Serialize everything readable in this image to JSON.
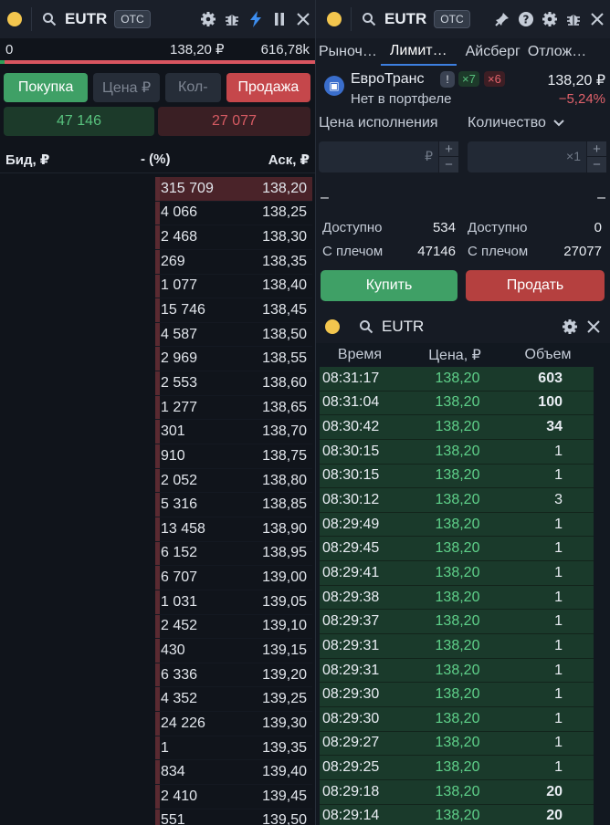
{
  "book": {
    "symbol": "EUTR",
    "otc_label": "OTC",
    "bid_volume_text": "0",
    "last_price": "138,20 ₽",
    "ask_volume_text": "616,78k",
    "buy_label": "Покупка",
    "price_field": "Цена ₽",
    "qty_field": "Кол-",
    "sell_label": "Продажа",
    "buy_volume": "47 146",
    "sell_volume": "27 077",
    "col_bid": "Бид, ₽",
    "col_pct": "- (%)",
    "col_ask": "Аск, ₽",
    "asks": [
      {
        "q": "315 709",
        "p": "138,20"
      },
      {
        "q": "4 066",
        "p": "138,25"
      },
      {
        "q": "2 468",
        "p": "138,30"
      },
      {
        "q": "269",
        "p": "138,35"
      },
      {
        "q": "1 077",
        "p": "138,40"
      },
      {
        "q": "15 746",
        "p": "138,45"
      },
      {
        "q": "4 587",
        "p": "138,50"
      },
      {
        "q": "2 969",
        "p": "138,55"
      },
      {
        "q": "2 553",
        "p": "138,60"
      },
      {
        "q": "1 277",
        "p": "138,65"
      },
      {
        "q": "301",
        "p": "138,70"
      },
      {
        "q": "910",
        "p": "138,75"
      },
      {
        "q": "2 052",
        "p": "138,80"
      },
      {
        "q": "5 316",
        "p": "138,85"
      },
      {
        "q": "13 458",
        "p": "138,90"
      },
      {
        "q": "6 152",
        "p": "138,95"
      },
      {
        "q": "6 707",
        "p": "139,00"
      },
      {
        "q": "1 031",
        "p": "139,05"
      },
      {
        "q": "2 452",
        "p": "139,10"
      },
      {
        "q": "430",
        "p": "139,15"
      },
      {
        "q": "6 336",
        "p": "139,20"
      },
      {
        "q": "4 352",
        "p": "139,25"
      },
      {
        "q": "24 226",
        "p": "139,30"
      },
      {
        "q": "1",
        "p": "139,35"
      },
      {
        "q": "834",
        "p": "139,40"
      },
      {
        "q": "2 410",
        "p": "139,45"
      },
      {
        "q": "551",
        "p": "139,50"
      }
    ]
  },
  "order": {
    "symbol": "EUTR",
    "otc_label": "OTC",
    "tabs": [
      "Рыноч…",
      "Лимит…",
      "Айсберг",
      "Отлож…"
    ],
    "active_tab": 1,
    "instrument_name": "ЕвроТранс",
    "badge_info": "!",
    "badge_buy": "×7",
    "badge_sell": "×6",
    "price": "138,20 ₽",
    "portfolio_status": "Нет в портфеле",
    "change": "−5,24%",
    "price_label": "Цена исполнения",
    "qty_label": "Количество",
    "price_unit": "₽",
    "qty_unit": "×1",
    "plus": "+",
    "minus": "−",
    "dash": "–",
    "available_label": "Доступно",
    "leverage_label": "С плечом",
    "buy_available": "534",
    "buy_leverage": "47146",
    "sell_available": "0",
    "sell_leverage": "27077",
    "buy_button": "Купить",
    "sell_button": "Продать",
    "colors": {
      "buy": "#3fa066",
      "sell": "#b5403f"
    }
  },
  "trades": {
    "symbol": "EUTR",
    "col_time": "Время",
    "col_price": "Цена, ₽",
    "col_volume": "Объем",
    "rows": [
      {
        "t": "08:31:17",
        "p": "138,20",
        "v": "603",
        "b": true
      },
      {
        "t": "08:31:04",
        "p": "138,20",
        "v": "100",
        "b": true
      },
      {
        "t": "08:30:42",
        "p": "138,20",
        "v": "34",
        "b": true
      },
      {
        "t": "08:30:15",
        "p": "138,20",
        "v": "1",
        "b": false
      },
      {
        "t": "08:30:15",
        "p": "138,20",
        "v": "1",
        "b": false
      },
      {
        "t": "08:30:12",
        "p": "138,20",
        "v": "3",
        "b": false
      },
      {
        "t": "08:29:49",
        "p": "138,20",
        "v": "1",
        "b": false
      },
      {
        "t": "08:29:45",
        "p": "138,20",
        "v": "1",
        "b": false
      },
      {
        "t": "08:29:41",
        "p": "138,20",
        "v": "1",
        "b": false
      },
      {
        "t": "08:29:38",
        "p": "138,20",
        "v": "1",
        "b": false
      },
      {
        "t": "08:29:37",
        "p": "138,20",
        "v": "1",
        "b": false
      },
      {
        "t": "08:29:31",
        "p": "138,20",
        "v": "1",
        "b": false
      },
      {
        "t": "08:29:31",
        "p": "138,20",
        "v": "1",
        "b": false
      },
      {
        "t": "08:29:30",
        "p": "138,20",
        "v": "1",
        "b": false
      },
      {
        "t": "08:29:30",
        "p": "138,20",
        "v": "1",
        "b": false
      },
      {
        "t": "08:29:27",
        "p": "138,20",
        "v": "1",
        "b": false
      },
      {
        "t": "08:29:25",
        "p": "138,20",
        "v": "1",
        "b": false
      },
      {
        "t": "08:29:18",
        "p": "138,20",
        "v": "20",
        "b": true
      },
      {
        "t": "08:29:14",
        "p": "138,20",
        "v": "20",
        "b": true
      }
    ]
  }
}
